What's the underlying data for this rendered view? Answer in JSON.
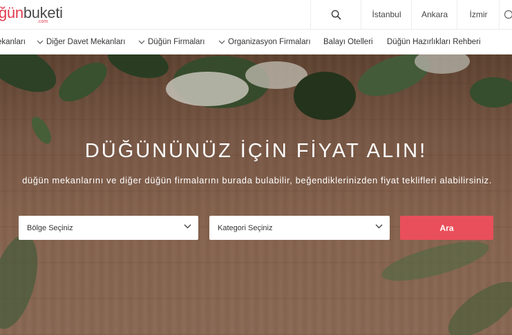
{
  "logo": {
    "part1": "ğün",
    "part2": "buketi",
    "suffix": ".com"
  },
  "header": {
    "search_icon": "search-icon",
    "cities": [
      "İstanbul",
      "Ankara",
      "İzmir"
    ]
  },
  "nav": [
    {
      "label": "ekanları",
      "has_chevron": false
    },
    {
      "label": "Diğer Davet Mekanları",
      "has_chevron": true
    },
    {
      "label": "Düğün Firmaları",
      "has_chevron": true
    },
    {
      "label": "Organizasyon Firmaları",
      "has_chevron": true
    },
    {
      "label": "Balayı Otelleri",
      "has_chevron": false
    },
    {
      "label": "Düğün Hazırlıkları Rehberi",
      "has_chevron": false
    }
  ],
  "hero": {
    "title": "DÜĞÜNÜNÜZ İÇİN FİYAT ALIN!",
    "subtitle": "düğün mekanlarını ve diğer düğün firmalarını burada bulabilir, beğendiklerinizden fiyat teklifleri alabilirsiniz.",
    "region_select": "Bölge Seçiniz",
    "category_select": "Kategori Seçiniz",
    "search_button": "Ara"
  },
  "colors": {
    "accent": "#e94f5a",
    "brand_red": "#e23a4f"
  }
}
